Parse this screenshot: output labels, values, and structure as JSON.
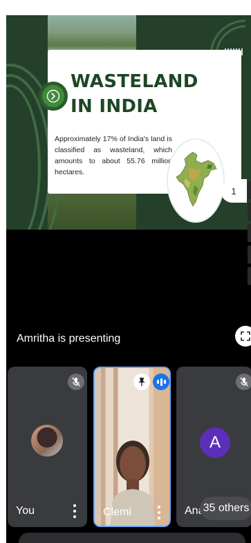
{
  "slide": {
    "title": "WASTELAND IN INDIA",
    "body": "Approximately 17% of India's land is classified as wasteland, which amounts to about 55.76 million hectares.",
    "page_indicator": "1"
  },
  "presenting_text": "Amritha is presenting",
  "participants": [
    {
      "name": "You",
      "mic": "off"
    },
    {
      "name": "Clemi",
      "mic": "speaking",
      "pinned": true
    },
    {
      "name": "Ana",
      "mic": "off",
      "avatar_letter": "A"
    }
  ],
  "others_count_label": "35 others",
  "colors": {
    "slide_bg": "#25402a",
    "title_green": "#1f4626",
    "accent_green": "#3f8a3b",
    "active_border": "#6ea5f0",
    "speaking_blue": "#1a73e8",
    "avatar_purple": "#5b2fb8"
  },
  "icons": [
    "arrow-right-circle-icon",
    "india-map-image",
    "fullscreen-icon",
    "mic-off-icon",
    "pin-icon",
    "speaking-indicator-icon",
    "more-vert-icon"
  ]
}
